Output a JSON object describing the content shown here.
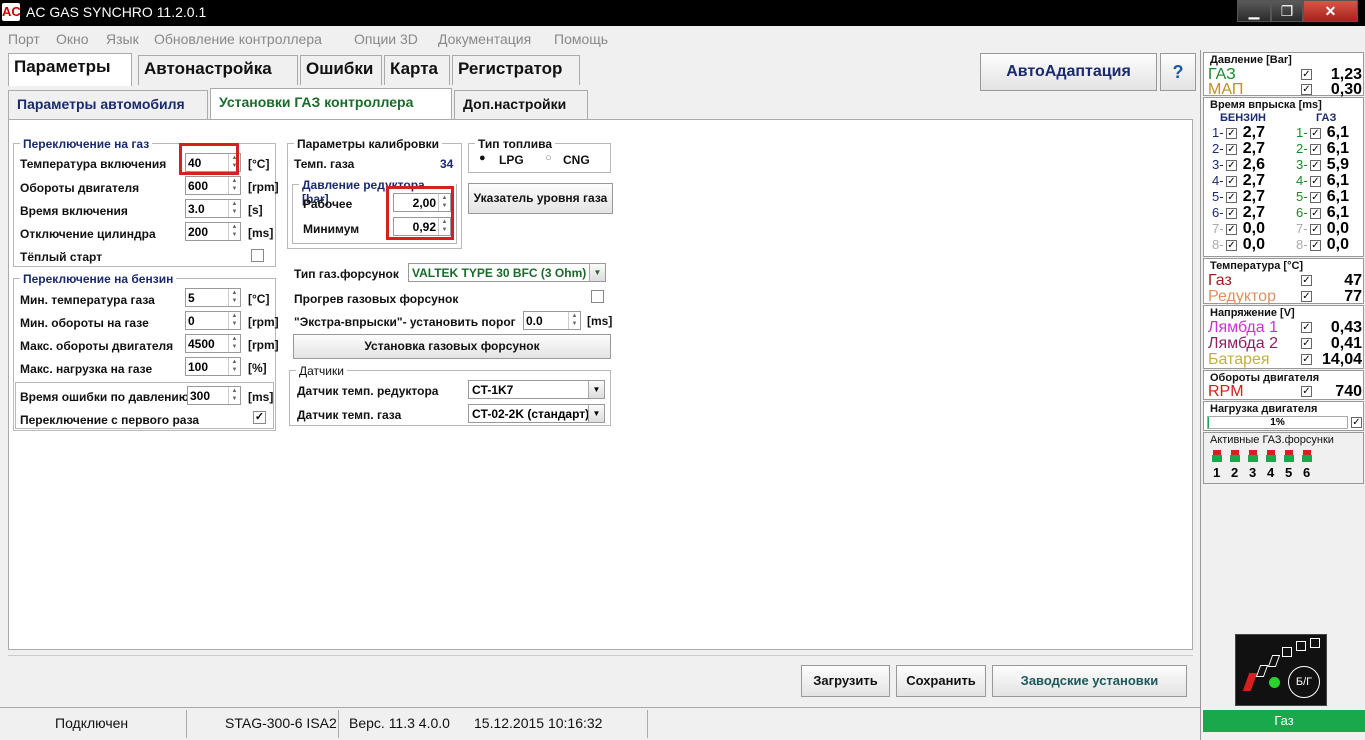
{
  "window": {
    "title": "AC GAS SYNCHRO  11.2.0.1",
    "logo": "AC",
    "min_glyph": "▁",
    "max_glyph": "❐",
    "close_glyph": "✕"
  },
  "menu": [
    "Порт",
    "Окно",
    "Язык",
    "Обновление контроллера",
    "Опции 3D",
    "Документация",
    "Помощь"
  ],
  "tabs_main": [
    "Параметры",
    "Автонастройка",
    "Ошибки",
    "Карта",
    "Регистратор"
  ],
  "tabs_sub": [
    "Параметры автомобиля",
    "Установки ГАЗ контроллера",
    "Доп.настройки"
  ],
  "auto_adapt": {
    "label": "АвтоАдаптация",
    "icon": "?"
  },
  "switch_gas": {
    "title": "Переключение на газ",
    "rows": [
      {
        "label": "Температура включения",
        "value": "40",
        "unit": "[°C]"
      },
      {
        "label": "Обороты двигателя",
        "value": "600",
        "unit": "[rpm]"
      },
      {
        "label": "Время включения",
        "value": "3.0",
        "unit": "[s]"
      },
      {
        "label": "Отключение цилиндра",
        "value": "200",
        "unit": "[ms]"
      }
    ],
    "warm_start": "Тёплый старт"
  },
  "switch_petrol": {
    "title": "Переключение на бензин",
    "rows": [
      {
        "label": "Мин. температура газа",
        "value": "5",
        "unit": "[°C]"
      },
      {
        "label": "Мин. обороты на газе",
        "value": "0",
        "unit": "[rpm]"
      },
      {
        "label": "Макс. обороты двигателя",
        "value": "4500",
        "unit": "[rpm]"
      },
      {
        "label": "Макс. нагрузка на газе",
        "value": "100",
        "unit": "[%]"
      }
    ],
    "error_time": {
      "label": "Время ошибки по давлению",
      "value": "300",
      "unit": "[ms]"
    },
    "first_switch": "Переключение с первого раза",
    "first_switch_check": "✓"
  },
  "calibration": {
    "title": "Параметры калибровки",
    "gas_temp_label": "Темп. газа",
    "gas_temp_value": "34",
    "reducer_title": "Давление редуктора [bar]",
    "working_label": "Рабочее",
    "working_value": "2,00",
    "min_label": "Минимум",
    "min_value": "0,92"
  },
  "fuel": {
    "title": "Тип топлива",
    "lpg": "LPG",
    "cng": "CNG"
  },
  "gas_level_btn": "Указатель уровня газа",
  "injectors": {
    "type_label": "Тип газ.форсунок",
    "type_value": "VALTEK TYPE 30 BFC (3 Ohm)",
    "heating_label": "Прогрев газовых форсунок",
    "extra_label": "\"Экстра-впрыски\"- установить порог",
    "extra_value": "0.0",
    "extra_unit": "[ms]",
    "setup_btn": "Установка газовых форсунок"
  },
  "sensors": {
    "title": "Датчики",
    "reducer_label": "Датчик темп. редуктора",
    "reducer_value": "CT-1K7",
    "gas_label": "Датчик темп. газа",
    "gas_value": "CT-02-2K (стандарт)"
  },
  "buttons": {
    "load": "Загрузить",
    "save": "Сохранить",
    "factory": "Заводские установки"
  },
  "status": {
    "connected": "Подключен",
    "device": "STAG-300-6 ISA2",
    "version": "Верс. 11.3  4.0.0",
    "datetime": "15.12.2015 10:16:32"
  },
  "right": {
    "pressure": {
      "title": "Давление [Bar]",
      "gas_label": "ГАЗ",
      "gas_value": "1,23",
      "map_label": "МАП",
      "map_value": "0,30"
    },
    "inject": {
      "title": "Время впрыска [ms]",
      "petrol_head": "БЕНЗИН",
      "gas_head": "ГАЗ",
      "petrol": [
        "2,7",
        "2,7",
        "2,6",
        "2,7",
        "2,7",
        "2,7",
        "0,0",
        "0,0"
      ],
      "gas": [
        "6,1",
        "6,1",
        "5,9",
        "6,1",
        "6,1",
        "6,1",
        "0,0",
        "0,0"
      ]
    },
    "temperature": {
      "title": "Температура  [°C]",
      "gas_label": "Газ",
      "gas_value": "47",
      "red_label": "Редуктор",
      "red_value": "77"
    },
    "voltage": {
      "title": "Напряжение [V]",
      "l1_label": "Лямбда 1",
      "l1_value": "0,43",
      "l2_label": "Лямбда 2",
      "l2_value": "0,41",
      "bat_label": "Батарея",
      "bat_value": "14,04"
    },
    "rpm": {
      "title": "Обороты двигателя",
      "label": "RPM",
      "value": "740"
    },
    "load": {
      "title": "Нагрузка двигателя",
      "value": "1%",
      "percent": 1
    },
    "active": {
      "title": "Активные ГАЗ.форсунки",
      "nums": [
        "1",
        "2",
        "3",
        "4",
        "5",
        "6"
      ]
    },
    "switch_label": "Б/Г",
    "gas_status": "Газ"
  }
}
